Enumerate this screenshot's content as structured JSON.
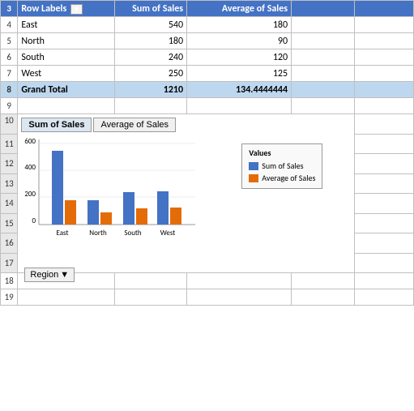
{
  "rows": {
    "row3": {
      "num": "3",
      "col_b": "Row Labels",
      "col_c": "Sum of Sales",
      "col_d": "Average of Sales"
    },
    "row4": {
      "num": "4",
      "label": "East",
      "sum": "540",
      "avg": "180"
    },
    "row5": {
      "num": "5",
      "label": "North",
      "sum": "180",
      "avg": "90"
    },
    "row6": {
      "num": "6",
      "label": "South",
      "sum": "240",
      "avg": "120"
    },
    "row7": {
      "num": "7",
      "label": "West",
      "sum": "250",
      "avg": "125"
    },
    "row8": {
      "num": "8",
      "label": "Grand Total",
      "sum": "1210",
      "avg": "134.4444444"
    },
    "row9": {
      "num": "9"
    },
    "row10": {
      "num": "10"
    },
    "row17": {
      "num": "17"
    },
    "row18": {
      "num": "18"
    },
    "row19": {
      "num": "19"
    }
  },
  "chart": {
    "btn1": "Sum of Sales",
    "btn2": "Average of Sales",
    "yLabels": [
      "600",
      "400",
      "200",
      "0"
    ],
    "xLabels": [
      "East",
      "North",
      "South",
      "West"
    ],
    "legend": {
      "title": "Values",
      "item1": "Sum of Sales",
      "item2": "Average of Sales"
    },
    "color1": "#4472c4",
    "color2": "#e36c09",
    "bars": [
      {
        "region": "East",
        "sum": 540,
        "avg": 180
      },
      {
        "region": "North",
        "sum": 180,
        "avg": 90
      },
      {
        "region": "South",
        "sum": 240,
        "avg": 120
      },
      {
        "region": "West",
        "sum": 250,
        "avg": 125
      }
    ],
    "maxVal": 600
  },
  "regionBtn": "Region"
}
